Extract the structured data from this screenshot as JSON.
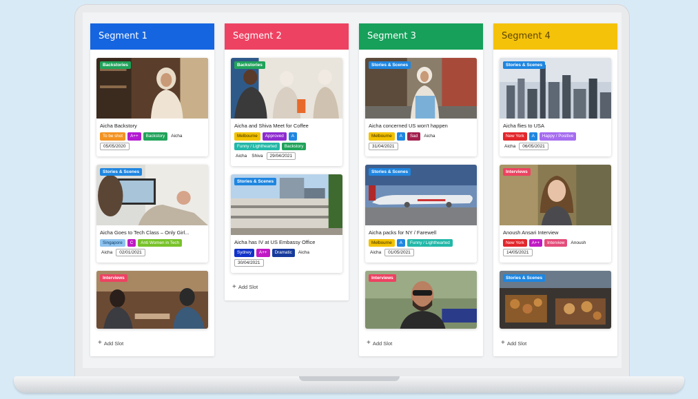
{
  "colors": {
    "seg1": "#1565e0",
    "seg2": "#ee4262",
    "seg3": "#16a05a",
    "seg4": "#f5c20a",
    "orange": "#f39322",
    "purple": "#b31bd2",
    "green": "#20a35a",
    "yellow": "#f2c200",
    "violet": "#8e2bcf",
    "blue": "#1f86e0",
    "maroon": "#a2204e",
    "teal": "#22b8a8",
    "lime": "#78c22a",
    "skyblue": "#8fc3ef",
    "magenta": "#c01ac4",
    "navy": "#173a9c",
    "red": "#e2262b",
    "pink": "#e44c7a",
    "lavender": "#a56cf0",
    "darkblue": "#1133c8"
  },
  "columns": [
    {
      "title": "Segment 1",
      "add_slot": "Add Slot",
      "cards": [
        {
          "image_tag": "Backstories",
          "title": "Aicha Backstory",
          "tags": [
            "To be shot",
            "A++",
            "Backstory"
          ],
          "people": [
            "Aicha"
          ],
          "date": "05/05/2020"
        },
        {
          "image_tag": "Stories & Scenes",
          "title": "Aicha Goes to Tech Class – Only Girl...",
          "tags": [
            "Singapore",
            "C",
            "Anti Women in Tech"
          ],
          "people": [
            "Aicha"
          ],
          "date": "02/01/2021"
        },
        {
          "image_tag": "Interviews"
        }
      ]
    },
    {
      "title": "Segment 2",
      "add_slot": "Add Slot",
      "cards": [
        {
          "image_tag": "Backstories",
          "title": "Aicha and Shiva Meet for Coffee",
          "tags": [
            "Melbourne",
            "Approved",
            "A",
            "Funny / Lighthearted",
            "Backstory"
          ],
          "people": [
            "Aicha",
            "Shiva"
          ],
          "date": "29/04/2021"
        },
        {
          "image_tag": "Stories & Scenes",
          "title": "Aicha has IV at US Embassy Office",
          "tags": [
            "Sydney",
            "A++",
            "Dramatic"
          ],
          "people": [
            "Aicha"
          ],
          "date": "30/04/2021"
        }
      ]
    },
    {
      "title": "Segment 3",
      "add_slot": "Add Slot",
      "cards": [
        {
          "image_tag": "Stories & Scenes",
          "title": "Aicha concerned US won't happen",
          "tags": [
            "Melbourne",
            "A",
            "Sad"
          ],
          "people": [
            "Aicha"
          ],
          "date": "31/04/2021"
        },
        {
          "image_tag": "Stories & Scenes",
          "title": "Aicha packs for NY / Farewell",
          "tags": [
            "Melbourne",
            "A",
            "Funny / Lighthearted"
          ],
          "people": [
            "Aicha"
          ],
          "date": "01/05/2021"
        },
        {
          "image_tag": "Interviews"
        }
      ]
    },
    {
      "title": "Segment 4",
      "add_slot": "Add Slot",
      "cards": [
        {
          "image_tag": "Stories & Scenes",
          "title": "Aicha flies to USA",
          "tags": [
            "New York",
            "A",
            "Happy / Positive"
          ],
          "people": [
            "Aicha"
          ],
          "date": "06/05/2021"
        },
        {
          "image_tag": "Interviews",
          "title": "Anoush Ansari Interview",
          "tags": [
            "New York",
            "A++",
            "Interview"
          ],
          "people": [
            "Anoush"
          ],
          "date": "14/05/2021"
        },
        {
          "image_tag": "Stories & Scenes"
        }
      ]
    }
  ]
}
